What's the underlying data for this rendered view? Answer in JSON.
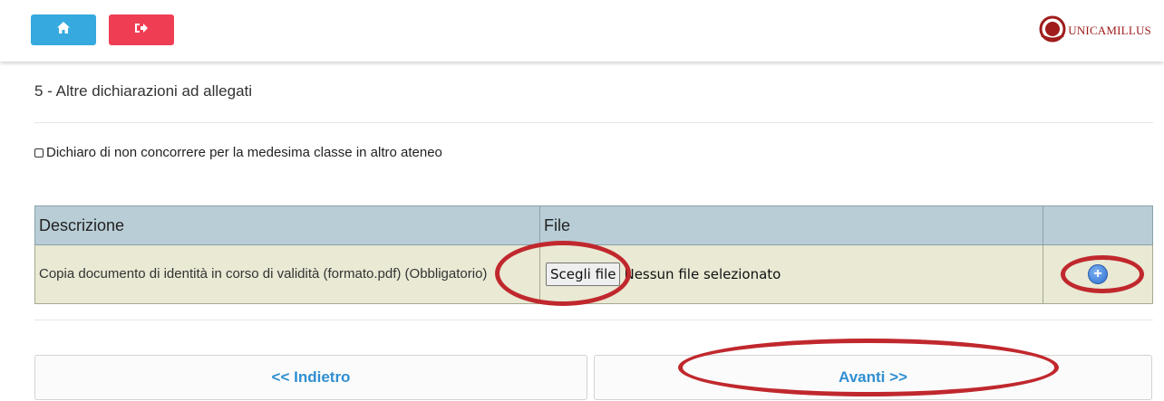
{
  "header": {
    "home_icon": "home-icon",
    "exit_icon": "sign-out-icon",
    "home_color": "#36a9df",
    "exit_color": "#ef3e53",
    "logo_text": "UNICAMILLUS"
  },
  "section": {
    "title": "5 - Altre dichiarazioni ad allegati",
    "declaration_label": "Dichiaro di non concorrere per la medesima classe in altro ateneo",
    "declaration_checked": false
  },
  "table": {
    "headers": [
      "Descrizione",
      "File",
      ""
    ],
    "rows": [
      {
        "description": "Copia documento di identità in corso di validità (formato.pdf) (Obbligatorio)",
        "choose_label": "Scegli file",
        "file_status": "Nessun file selezionato",
        "add_icon": "plus-circle-icon"
      }
    ]
  },
  "navigation": {
    "back_label": "<< Indietro",
    "next_label": "Avanti >>"
  },
  "colors": {
    "accent": "#2f8fd1",
    "annotation": "#c0282d"
  }
}
